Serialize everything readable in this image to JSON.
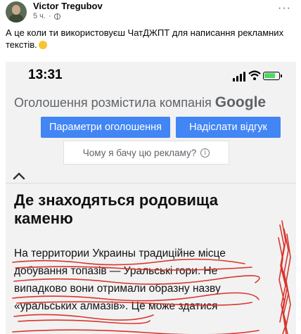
{
  "post": {
    "author": "Victor Tregubov",
    "time": "5 ч.",
    "more_label": "···",
    "text": "А це коли ти використовуєш ЧатДЖПТ для написання рекламних текстів."
  },
  "phone": {
    "time": "13:31"
  },
  "ad": {
    "label": "Оголошення розмістила компанія",
    "brand": "Google",
    "settings_button": "Параметри оголошення",
    "feedback_button": "Надіслати відгук",
    "why_text": "Чому я бачу цю рекламу?",
    "info_glyph": "i"
  },
  "article": {
    "title_line1": "Де знаходяться родовища",
    "title_line2": "каменю",
    "body_lines": [
      "На территории Украины традиційне місце",
      "добування топазів — Уральські гори. Не",
      "випадково вони отримали образну назву",
      "«уральських алмазів». Це може здатися"
    ]
  },
  "colors": {
    "button_blue": "#4285f4",
    "scribble_red": "#d9342b"
  }
}
